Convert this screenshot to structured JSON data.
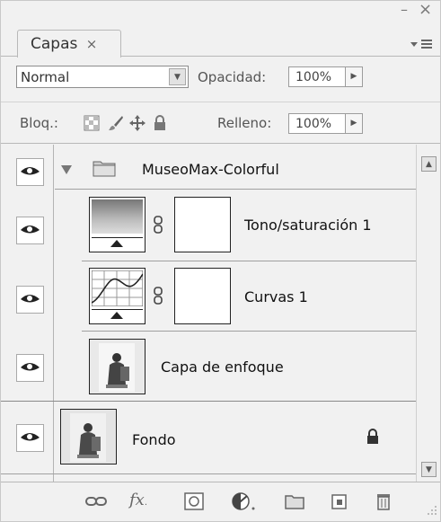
{
  "panel": {
    "tab_label": "Capas",
    "tab_close": "×",
    "minimize_glyph": "–",
    "close_glyph": "×",
    "menu_glyph": "▾☰"
  },
  "blend": {
    "mode": "Normal",
    "opacity_label": "Opacidad:",
    "opacity_value": "100%"
  },
  "lock": {
    "label": "Bloq.:",
    "fill_label": "Relleno:",
    "fill_value": "100%"
  },
  "layers": [
    {
      "name": "MuseoMax-Colorful",
      "type": "group",
      "visible": true,
      "expanded": true
    },
    {
      "name": "Tono/saturación 1",
      "type": "adjustment-hue-saturation",
      "visible": true,
      "linked_mask": true
    },
    {
      "name": "Curvas 1",
      "type": "adjustment-curves",
      "visible": true,
      "linked_mask": true
    },
    {
      "name": "Capa de enfoque",
      "type": "image",
      "visible": true
    },
    {
      "name": "Fondo",
      "type": "background",
      "visible": true,
      "locked": true
    }
  ],
  "toolbar": {
    "fx_label": "fx"
  },
  "icons": {
    "eye": "eye-icon",
    "folder": "folder-icon",
    "link": "link-icon",
    "lock": "lock-icon"
  },
  "colors": {
    "panel_bg": "#f1f1f1",
    "border": "#b8b8b8",
    "text": "#1a1a1a"
  }
}
